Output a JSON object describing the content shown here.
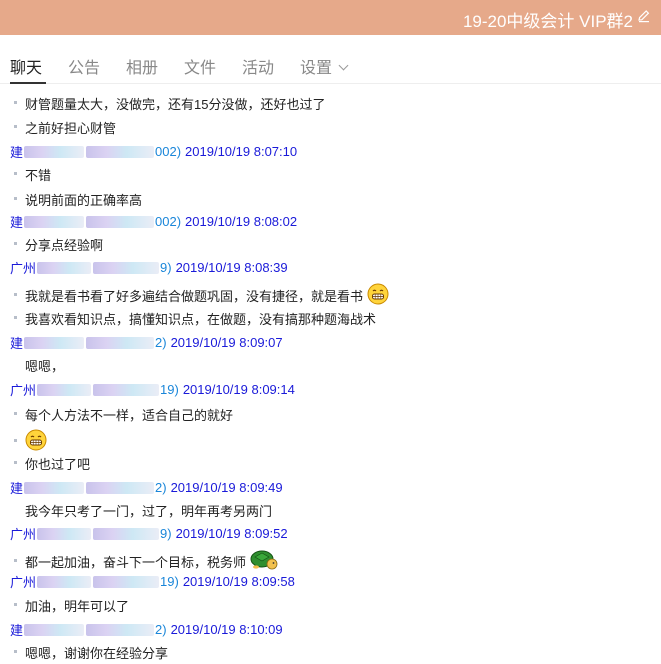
{
  "window": {
    "title": "19-20中级会计 VIP群2"
  },
  "tabs": [
    "聊天",
    "公告",
    "相册",
    "文件",
    "活动",
    "设置"
  ],
  "messages": [
    {
      "type": "text",
      "text": "财管题量太大，没做完，还有15分没做，还好也过了"
    },
    {
      "type": "text",
      "text": "之前好担心财管"
    },
    {
      "type": "meta",
      "sender": "建",
      "id_tail": "002)",
      "time": "2019/10/19 8:07:10"
    },
    {
      "type": "text",
      "text": "不错"
    },
    {
      "type": "text",
      "text": "说明前面的正确率高"
    },
    {
      "type": "meta",
      "sender": "建",
      "id_tail": "002)",
      "time": "2019/10/19 8:08:02"
    },
    {
      "type": "text",
      "text": "分享点经验啊"
    },
    {
      "type": "meta",
      "sender": "广州",
      "id_tail": "9)",
      "time": "2019/10/19 8:08:39"
    },
    {
      "type": "text",
      "text": "我就是看书看了好多遍结合做题巩固，没有捷径，就是看书",
      "emoji": "grin-emoji"
    },
    {
      "type": "text",
      "text": "我喜欢看知识点，搞懂知识点，在做题，没有搞那种题海战术"
    },
    {
      "type": "meta",
      "sender": "建",
      "id_tail": "2)",
      "time": "2019/10/19 8:09:07"
    },
    {
      "type": "text",
      "text": "嗯嗯，",
      "nodot": true
    },
    {
      "type": "meta",
      "sender": "广州",
      "id_tail": "19)",
      "time": "2019/10/19 8:09:14"
    },
    {
      "type": "text",
      "text": "每个人方法不一样，适合自己的就好"
    },
    {
      "type": "emoji",
      "emoji": "grin-emoji"
    },
    {
      "type": "text",
      "text": "你也过了吧"
    },
    {
      "type": "meta",
      "sender": "建",
      "id_tail": "2)",
      "time": "2019/10/19 8:09:49"
    },
    {
      "type": "text",
      "text": "我今年只考了一门，过了，明年再考另两门",
      "nodot": true
    },
    {
      "type": "meta",
      "sender": "广州",
      "id_tail": "9)",
      "time": "2019/10/19 8:09:52"
    },
    {
      "type": "text",
      "text": "都一起加油，奋斗下一个目标，税务师",
      "emoji": "turtle-emoji"
    },
    {
      "type": "meta",
      "sender": "广州",
      "id_tail": "19)",
      "time": "2019/10/19 8:09:58"
    },
    {
      "type": "text",
      "text": "加油，明年可以了"
    },
    {
      "type": "meta",
      "sender": "建",
      "id_tail": "2)",
      "time": "2019/10/19 8:10:09"
    },
    {
      "type": "text",
      "text": "嗯嗯，谢谢你在经验分享"
    }
  ],
  "colors": {
    "titlebar": "#e6a98a",
    "meta": "#1a1ad9",
    "id_link": "#1a86d9"
  }
}
